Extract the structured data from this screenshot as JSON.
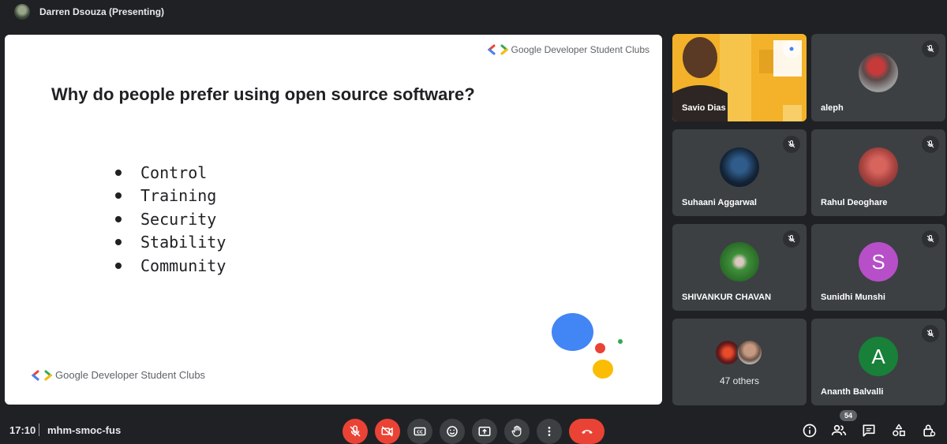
{
  "header": {
    "presenter_name": "Darren Dsouza (Presenting)"
  },
  "slide": {
    "brand_top": "Google Developer Student Clubs",
    "brand_bottom": "Google Developer Student Clubs",
    "title": "Why do people prefer using open source software?",
    "bullets": [
      "Control",
      "Training",
      "Security",
      "Stability",
      "Community"
    ],
    "brand_colors": {
      "blue": "#4285f4",
      "red": "#ea4335",
      "yellow": "#fbbc04",
      "green": "#34a853"
    }
  },
  "participants": [
    {
      "name": "Savio Dias",
      "video": true,
      "muted": false
    },
    {
      "name": "aleph",
      "muted": true
    },
    {
      "name": "Suhaani Aggarwal",
      "muted": true
    },
    {
      "name": "Rahul Deoghare",
      "muted": true
    },
    {
      "name": "SHIVANKUR CHAVAN",
      "muted": true
    },
    {
      "name": "Sunidhi Munshi",
      "initial": "S",
      "avatar_color": "#b64fc8",
      "muted": true
    },
    {
      "name": "47 others",
      "group": true
    },
    {
      "name": "Ananth Balvalli",
      "initial": "A",
      "avatar_color": "#188038",
      "muted": true
    }
  ],
  "footer": {
    "time": "17:10",
    "meeting_code": "mhm-smoc-fus",
    "participant_count": "54",
    "controls": [
      "mic-off-icon",
      "camera-off-icon",
      "captions-icon",
      "emoji-icon",
      "present-icon",
      "raise-hand-icon",
      "more-options-icon",
      "hang-up-icon"
    ],
    "side_controls": [
      "info-icon",
      "people-icon",
      "chat-icon",
      "activities-icon",
      "host-controls-icon"
    ]
  }
}
